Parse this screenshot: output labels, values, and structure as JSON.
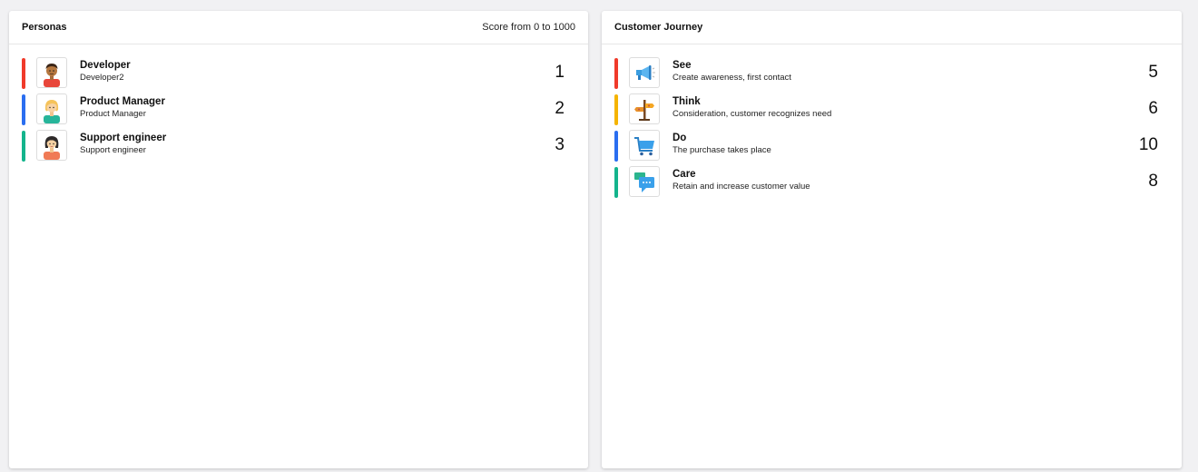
{
  "personas": {
    "title": "Personas",
    "score_caption": "Score from 0 to 1000",
    "items": [
      {
        "name": "Developer",
        "subtitle": "Developer2",
        "score": "1",
        "bar_color": "#f03a2a",
        "icon": "developer-avatar-icon"
      },
      {
        "name": "Product Manager",
        "subtitle": "Product Manager",
        "score": "2",
        "bar_color": "#2a6ef0",
        "icon": "product-manager-avatar-icon"
      },
      {
        "name": "Support engineer",
        "subtitle": "Support engineer",
        "score": "3",
        "bar_color": "#14b48c",
        "icon": "support-engineer-avatar-icon"
      }
    ]
  },
  "journey": {
    "title": "Customer Journey",
    "items": [
      {
        "name": "See",
        "subtitle": "Create awareness, first contact",
        "score": "5",
        "bar_color": "#f03a2a",
        "icon": "megaphone-icon"
      },
      {
        "name": "Think",
        "subtitle": "Consideration, customer recognizes need",
        "score": "6",
        "bar_color": "#f5b400",
        "icon": "signpost-icon"
      },
      {
        "name": "Do",
        "subtitle": "The purchase takes place",
        "score": "10",
        "bar_color": "#2a6ef0",
        "icon": "shopping-cart-icon"
      },
      {
        "name": "Care",
        "subtitle": "Retain and increase customer value",
        "score": "8",
        "bar_color": "#14b48c",
        "icon": "chat-bubbles-icon"
      }
    ]
  }
}
